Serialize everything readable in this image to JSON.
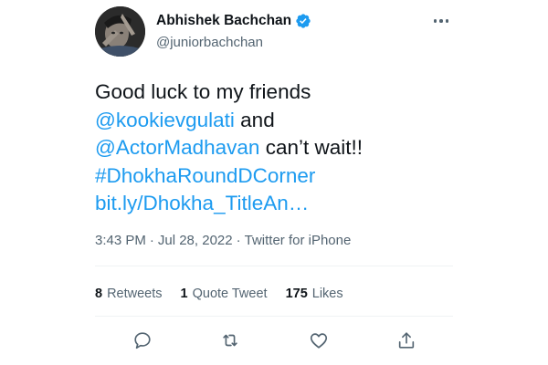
{
  "tweet": {
    "display_name": "Abhishek Bachchan",
    "handle": "@juniorbachchan",
    "verified": true,
    "more_icon": "more-horizontal-icon",
    "text": {
      "line1": "Good luck to my friends",
      "mention1": "@kookievgulati",
      "and": " and",
      "mention2": "@ActorMadhavan",
      "cant_wait": " can’t wait!!",
      "hashtag": "#DhokhaRoundDCorner",
      "link": "bit.ly/Dhokha_TitleAn…"
    },
    "meta": {
      "time": "3:43 PM",
      "separator1": "·",
      "date": "Jul 28, 2022",
      "separator2": "·",
      "source": "Twitter for iPhone"
    },
    "stats": {
      "retweets_count": "8",
      "retweets_label": "Retweets",
      "quotes_count": "1",
      "quotes_label": "Quote Tweet",
      "likes_count": "175",
      "likes_label": "Likes"
    },
    "actions": [
      "reply-icon",
      "retweet-icon",
      "like-icon",
      "share-icon"
    ],
    "colors": {
      "link": "#1d9bf0",
      "secondary_text": "#536471",
      "primary_text": "#0f1419",
      "divider": "#eff3f4"
    }
  }
}
